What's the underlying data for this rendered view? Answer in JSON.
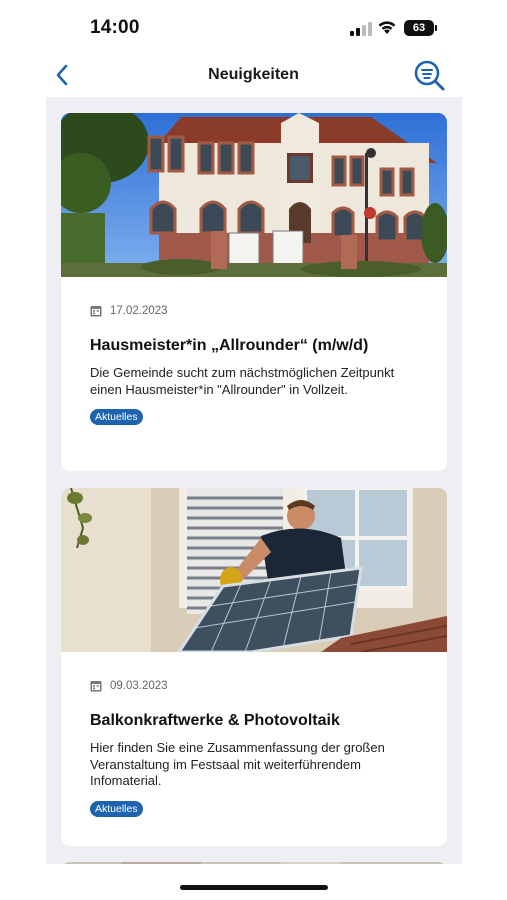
{
  "status_bar": {
    "time": "14:00",
    "battery": "63"
  },
  "nav": {
    "title": "Neuigkeiten",
    "back_icon": "chevron-left-icon",
    "search_icon": "search-filter-icon",
    "accent_color": "#1d63b0"
  },
  "news": [
    {
      "date": "17.02.2023",
      "title": "Hausmeister*in „Allrounder“ (m/w/d)",
      "text": "Die Gemeinde sucht zum nächstmöglichen Zeitpunkt einen Hausmeister*in \"Allrounder\" in Vollzeit.",
      "tag": "Aktuelles"
    },
    {
      "date": "09.03.2023",
      "title": "Balkonkraftwerke & Photovoltaik",
      "text": "Hier finden Sie eine Zusammenfassung der großen Veranstaltung im Festsaal mit weiterführendem Infomaterial.",
      "tag": "Aktuelles"
    }
  ]
}
